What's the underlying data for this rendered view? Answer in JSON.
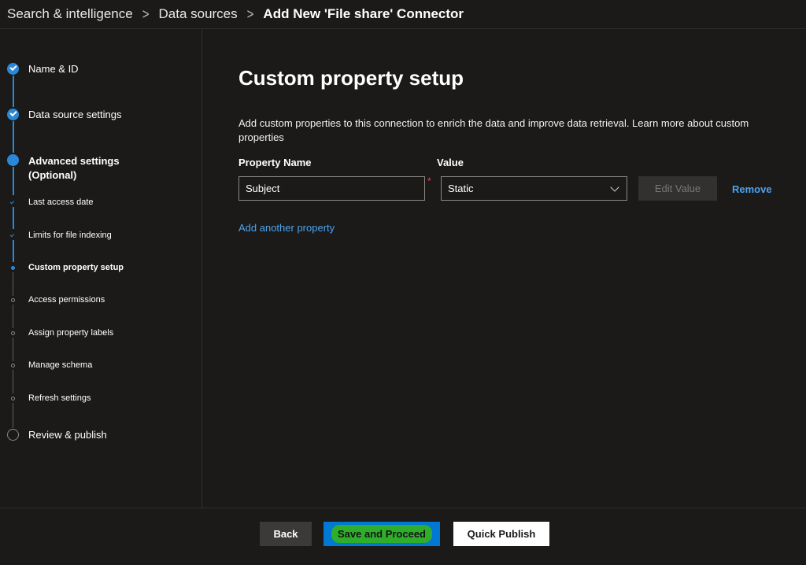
{
  "breadcrumb": {
    "items": [
      "Search & intelligence",
      "Data sources"
    ],
    "current": "Add New 'File share' Connector"
  },
  "steps": {
    "name_id": "Name & ID",
    "data_source_settings": "Data source settings",
    "advanced_settings_line1": "Advanced settings",
    "advanced_settings_line2": "(Optional)",
    "last_access_date": "Last access date",
    "limits_file_indexing": "Limits for file indexing",
    "custom_property_setup": "Custom property setup",
    "access_permissions": "Access permissions",
    "assign_property_labels": "Assign property labels",
    "manage_schema": "Manage schema",
    "refresh_settings": "Refresh settings",
    "review_publish": "Review & publish"
  },
  "main": {
    "title": "Custom property setup",
    "description": "Add custom properties to this connection to enrich the data and improve data retrieval. Learn more about custom properties",
    "property_name_label": "Property Name",
    "value_label": "Value",
    "property_name_value": "Subject",
    "required_mark": "*",
    "value_selected": "Static",
    "edit_value_label": "Edit Value",
    "remove_label": "Remove",
    "add_another_label": "Add another property"
  },
  "footer": {
    "back_label": "Back",
    "save_label": "Save and Proceed",
    "publish_label": "Quick Publish"
  },
  "colors": {
    "background": "#1b1a19",
    "accent": "#0078d4",
    "link": "#4ca3f0",
    "highlight": "#2fae2c"
  }
}
